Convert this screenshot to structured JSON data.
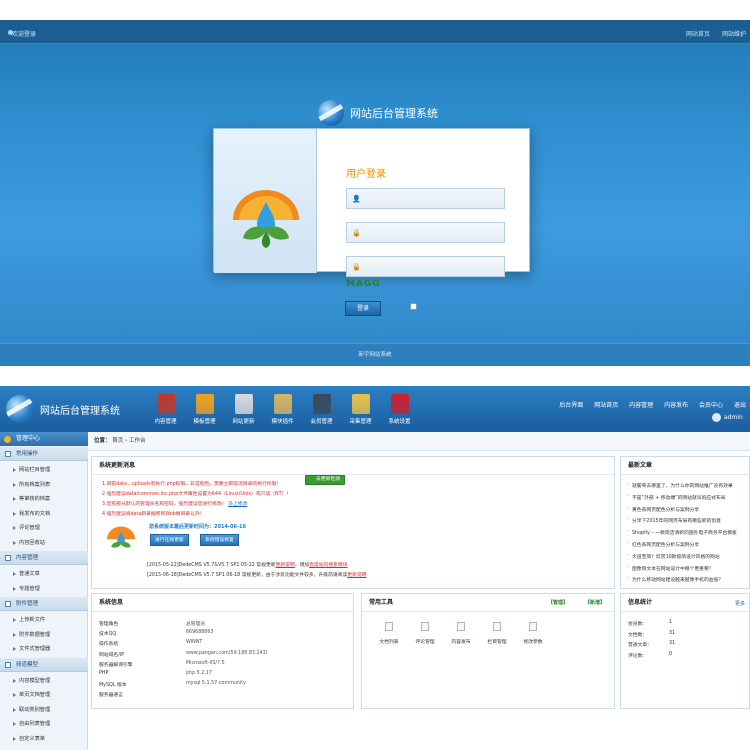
{
  "login": {
    "welcome": "欢迎登录",
    "top_links": [
      "网站首页",
      "网站维护"
    ],
    "brand_title": "网站后台管理系统",
    "form_title": "用户登录",
    "captcha_text": "MAGG",
    "login_button": "登录",
    "footer": "新宇网站系统"
  },
  "admin": {
    "brand_title": "网站后台管理系统",
    "nav": [
      {
        "label": "内容管理",
        "icon": "book-icon",
        "color": "#c0392b"
      },
      {
        "label": "模板管理",
        "icon": "folder-icon",
        "color": "#f0a21e"
      },
      {
        "label": "网站更新",
        "icon": "printer-icon",
        "color": "#d9d9d9"
      },
      {
        "label": "模块插件",
        "icon": "ruler-icon",
        "color": "#d8b463"
      },
      {
        "label": "会员管理",
        "icon": "user-icon",
        "color": "#3b4a5a"
      },
      {
        "label": "采集管理",
        "icon": "network-icon",
        "color": "#e9c14a"
      },
      {
        "label": "系统设置",
        "icon": "tools-icon",
        "color": "#c8202b"
      }
    ],
    "top_links": [
      "后台界面",
      "网站首页",
      "内容管理",
      "内容发布",
      "会员中心",
      "退出"
    ],
    "user": "admin",
    "sidebar": {
      "title": "管理中心",
      "groups": [
        {
          "title": "常用操作",
          "items": [
            "网站栏目管理",
            "所有档案列表",
            "等审核的档案",
            "我发布的文档",
            "评论管理",
            "内容回收站"
          ]
        },
        {
          "title": "内容管理",
          "items": [
            "普通文章",
            "专题管理"
          ]
        },
        {
          "title": "附件管理",
          "items": [
            "上传新文件",
            "附件数据管理",
            "文件式管理器"
          ]
        },
        {
          "title": "频道模型",
          "items": [
            "内容模型管理",
            "单页文档管理",
            "联动类别管理",
            "自由列表管理",
            "自定义表单"
          ]
        }
      ]
    },
    "breadcrumb": {
      "label": "位置：",
      "home": "首页",
      "sep": "›",
      "current": "工作台"
    },
    "update_panel": {
      "title": "系统更新消息",
      "check_button": "去更新检测",
      "messages": [
        {
          "text": "1.目前data，uploads有执行.php权限，非常危险，需要立即取消目录的执行权限！",
          "link": ""
        },
        {
          "text": "2.强烈建议data/common.inc.php文件属性设置为644（Linux/Unix）或只读（NT）！",
          "link": ""
        },
        {
          "text": "3.您有部分默认的管理员名和密码，强烈建议您进行修改！",
          "link": "马上修改"
        },
        {
          "text": "4.强烈建议将data目录搬移到Web根目录以外！",
          "link": ""
        }
      ],
      "version": "您系统版本最后更新时间为：2014-06-16",
      "btn_update": "进行在线更新",
      "btn_patch": "系统错误修复",
      "logs": [
        {
          "text": "[2015-05-22]DedeCMS V5.7&V5.7 SP1 05-22 常规更新",
          "link1": "更新说明",
          "mid": "，增加",
          "link2": "百度站内搜索模块"
        },
        {
          "text": "[2015-06-18]DedeCMS V5.7 SP1 06-18 常规更新，由于涉及功能文件较多，升级前请阅读",
          "link1": "更新说明",
          "mid": "",
          "link2": ""
        }
      ]
    },
    "news_panel": {
      "title": "最新文章",
      "items": [
        "就葡萄去哪里了，为什么你的网站推广没有效果",
        "不是“外部 + 移动端”的网站就叫响应式布局",
        "黄色系网页配色分析与案例分享",
        "分享下2015年的网页布局有哪些新的创意",
        "Shopify – 一款简洁清新的国外电子商务平台模板",
        "红色系网页配色分析与案例分享",
        "大道至简？欣赏10款极简设计风格的网站",
        "图像和文本在网站设计中哪个更重要？",
        "为什么移动网站建设越来越像手机的血强？"
      ]
    },
    "sys_panel": {
      "title": "系统信息",
      "rows": [
        {
          "k": "管理角色",
          "v": "总管理员"
        },
        {
          "k": "技术QQ",
          "v": "669688863"
        },
        {
          "k": "操作系统",
          "v": "WINNT"
        },
        {
          "k": "网站域名/IP",
          "v": "www.pangan.com(59.188.83.243)"
        },
        {
          "k": "服务器解译引擎",
          "v": "Microsoft-IIS/7.5"
        },
        {
          "k": "PHP",
          "v": "php 5.2.17"
        },
        {
          "k": "MySQL 版本",
          "v": "mysql 5.1.57-community"
        },
        {
          "k": "服务器语言",
          "v": ""
        }
      ]
    },
    "tools_panel": {
      "title": "常用工具",
      "manage": "【管理】",
      "add": "【新增】",
      "tools": [
        "文档列表",
        "评论管理",
        "内容发布",
        "栏目管理",
        "修改参数"
      ]
    },
    "stats_panel": {
      "title": "信息统计",
      "more": "更多",
      "rows": [
        {
          "k": "会员数：",
          "v": "1"
        },
        {
          "k": "文档数：",
          "v": "31"
        },
        {
          "k": "普通文章：",
          "v": "31"
        },
        {
          "k": "评论数：",
          "v": "0"
        }
      ]
    }
  }
}
